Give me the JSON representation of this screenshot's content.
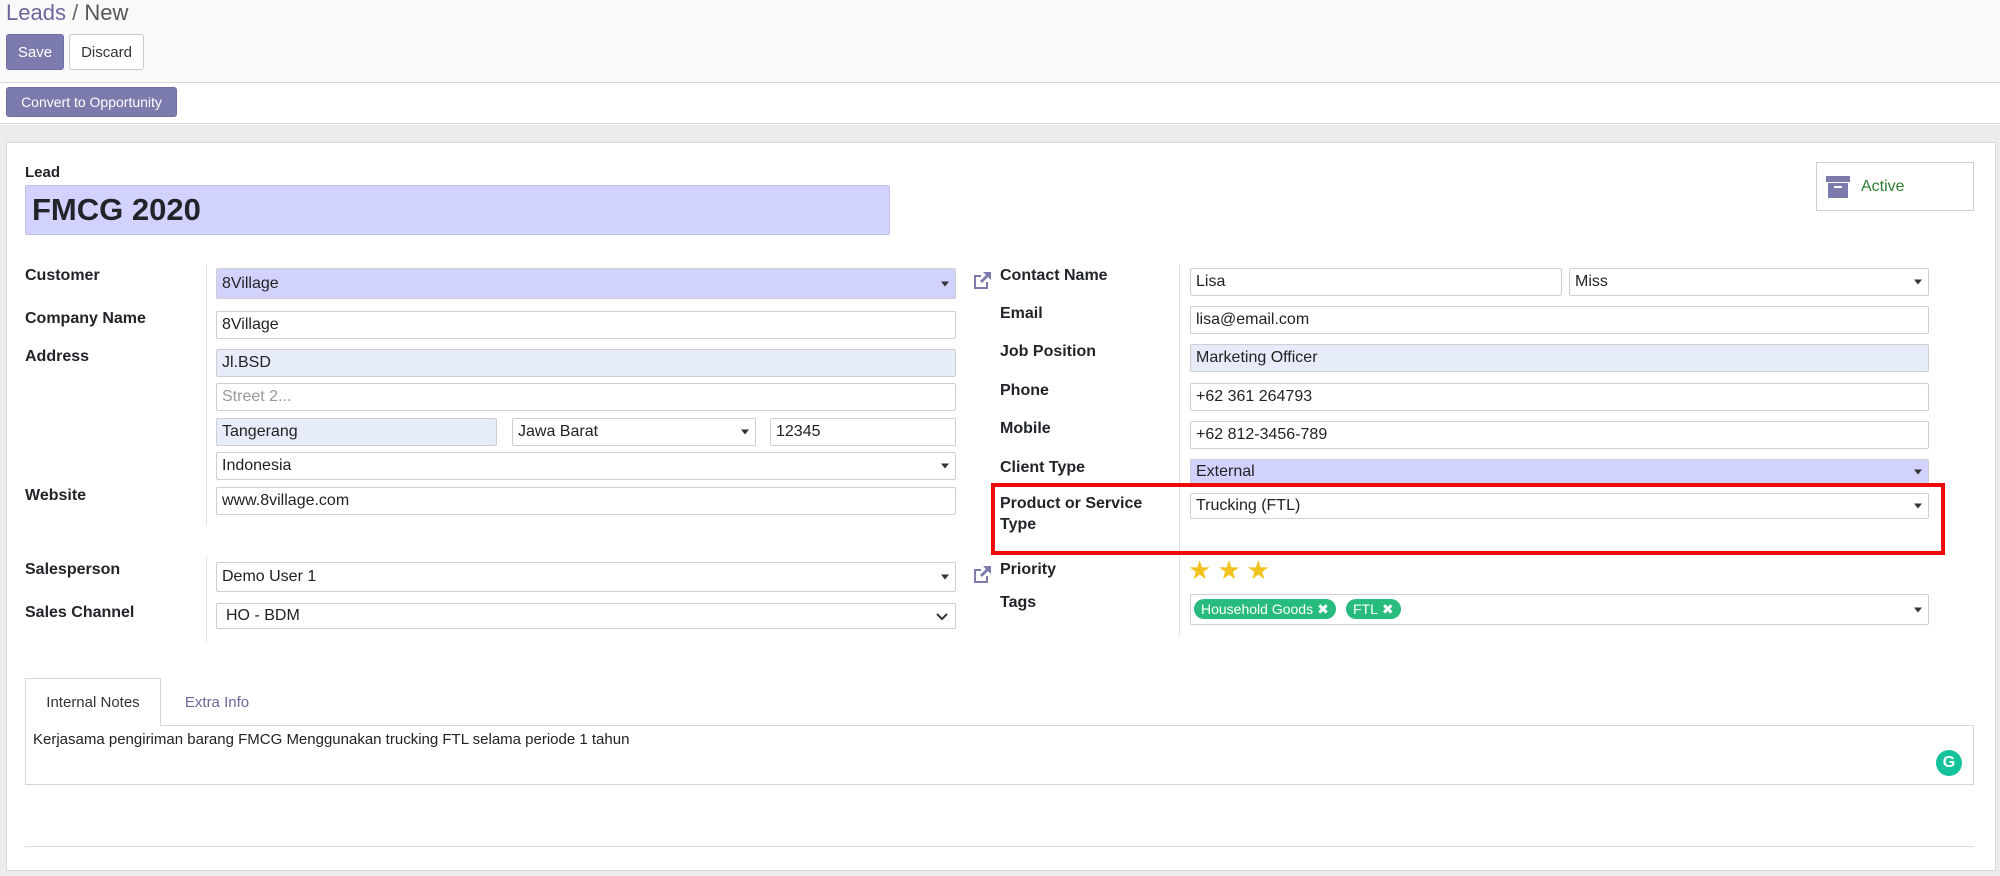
{
  "breadcrumb": {
    "parent": "Leads",
    "separator": "/",
    "current": "New"
  },
  "toolbar": {
    "save_label": "Save",
    "discard_label": "Discard"
  },
  "statusbar": {
    "convert_label": "Convert to Opportunity"
  },
  "lead": {
    "section_label": "Lead",
    "title": "FMCG 2020"
  },
  "status_button": {
    "label": "Active",
    "icon": "archive-icon"
  },
  "left": {
    "customer": {
      "label": "Customer",
      "value": "8Village"
    },
    "company_name": {
      "label": "Company Name",
      "value": "8Village"
    },
    "address": {
      "label": "Address",
      "street": "Jl.BSD",
      "street2_placeholder": "Street 2...",
      "city": "Tangerang",
      "state": "Jawa Barat",
      "zip": "12345",
      "country": "Indonesia"
    },
    "website": {
      "label": "Website",
      "value": "www.8village.com"
    },
    "salesperson": {
      "label": "Salesperson",
      "value": "Demo User 1"
    },
    "sales_channel": {
      "label": "Sales Channel",
      "value": "HO - BDM"
    }
  },
  "right": {
    "contact_name": {
      "label": "Contact Name",
      "value": "Lisa",
      "title": "Miss"
    },
    "email": {
      "label": "Email",
      "value": "lisa@email.com"
    },
    "job_position": {
      "label": "Job Position",
      "value": "Marketing Officer"
    },
    "phone": {
      "label": "Phone",
      "value": "+62 361 264793"
    },
    "mobile": {
      "label": "Mobile",
      "value": "+62 812-3456-789"
    },
    "client_type": {
      "label": "Client Type",
      "value": "External"
    },
    "product_type": {
      "label_line1": "Product or Service",
      "label_line2": "Type",
      "value": "Trucking (FTL)"
    },
    "priority": {
      "label": "Priority",
      "stars": 3,
      "max_stars": 3
    },
    "tags": {
      "label": "Tags",
      "items": [
        "Household Goods",
        "FTL"
      ]
    }
  },
  "tabs": {
    "internal_notes": "Internal Notes",
    "extra_info": "Extra Info"
  },
  "notes": {
    "text": "Kerjasama pengiriman barang FMCG Menggunakan trucking FTL selama periode 1 tahun"
  },
  "colors": {
    "primary": "#7c7bad",
    "required_bg": "#d2d2ff",
    "tag_bg": "#28bb7e",
    "star": "#f3c21f",
    "highlight": "#ee0b0b",
    "active_text": "#2e7d32"
  }
}
